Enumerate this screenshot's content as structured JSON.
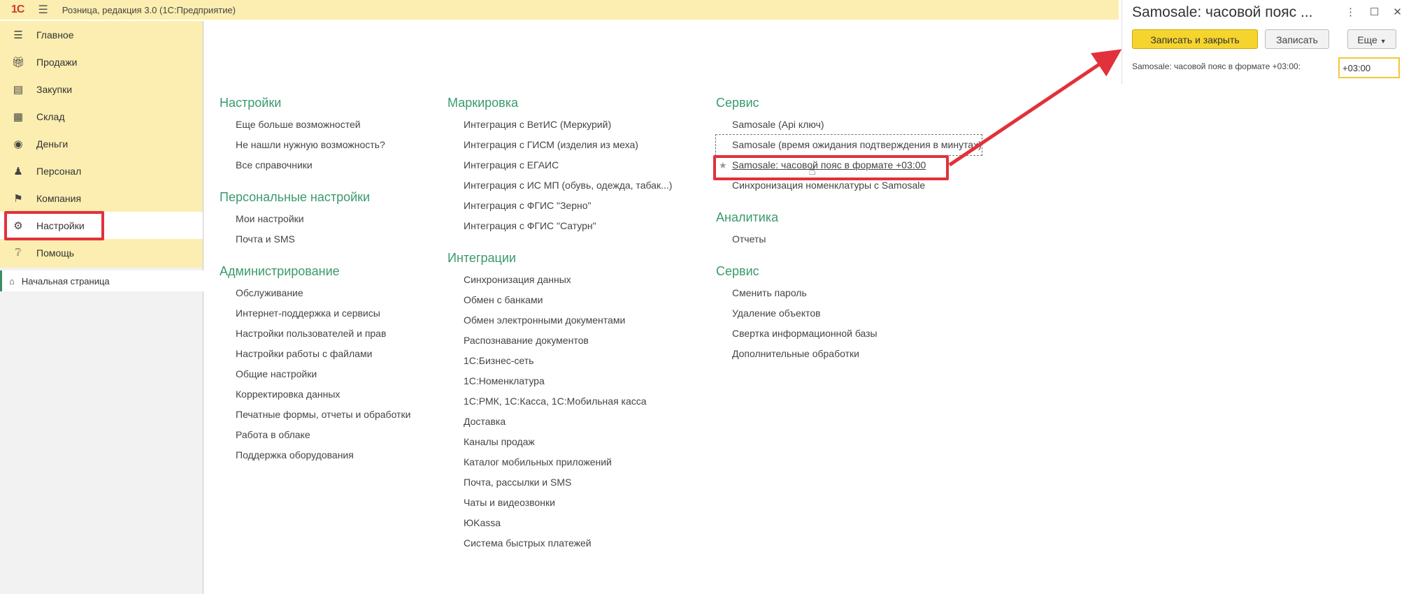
{
  "app": {
    "logo": "1С",
    "title": "Розница, редакция 3.0  (1С:Предприятие)"
  },
  "sidebar": {
    "items": [
      {
        "label": "Главное",
        "icon": "menu-icon"
      },
      {
        "label": "Продажи",
        "icon": "gift-icon"
      },
      {
        "label": "Закупки",
        "icon": "purchases-icon"
      },
      {
        "label": "Склад",
        "icon": "warehouse-icon"
      },
      {
        "label": "Деньги",
        "icon": "money-icon"
      },
      {
        "label": "Персонал",
        "icon": "people-icon"
      },
      {
        "label": "Компания",
        "icon": "flag-icon"
      },
      {
        "label": "Настройки",
        "icon": "gear-icon"
      },
      {
        "label": "Помощь",
        "icon": "help-icon"
      }
    ],
    "home": "Начальная страница"
  },
  "columns": [
    {
      "sections": [
        {
          "title": "Настройки",
          "links": [
            "Еще больше возможностей",
            "Не нашли нужную возможность?",
            "Все справочники"
          ]
        },
        {
          "title": "Персональные настройки",
          "links": [
            "Мои настройки",
            "Почта и SMS"
          ]
        },
        {
          "title": "Администрирование",
          "links": [
            "Обслуживание",
            "Интернет-поддержка и сервисы",
            "Настройки пользователей и прав",
            "Настройки работы с файлами",
            "Общие настройки",
            "Корректировка данных",
            "Печатные формы, отчеты и обработки",
            "Работа в облаке",
            "Поддержка оборудования"
          ]
        }
      ]
    },
    {
      "sections": [
        {
          "title": "Маркировка",
          "links": [
            "Интеграция с ВетИС (Меркурий)",
            "Интеграция с ГИСМ (изделия из меха)",
            "Интеграция с ЕГАИС",
            "Интеграция с ИС МП (обувь, одежда, табак...)",
            "Интеграция с ФГИС \"Зерно\"",
            "Интеграция с ФГИС \"Сатурн\""
          ]
        },
        {
          "title": "Интеграции",
          "links": [
            "Синхронизация данных",
            "Обмен с банками",
            "Обмен электронными документами",
            "Распознавание документов",
            "1С:Бизнес-сеть",
            "1С:Номенклатура",
            "1С:РМК, 1С:Касса, 1С:Мобильная касса",
            "Доставка",
            "Каналы продаж",
            "Каталог мобильных приложений",
            "Почта, рассылки и SMS",
            "Чаты и видеозвонки",
            "ЮKassa",
            "Система быстрых платежей"
          ]
        }
      ]
    },
    {
      "sections": [
        {
          "title": "Сервис",
          "links": [
            "Samosale (Api ключ)",
            "Samosale (время ожидания подтверждения в минутах)",
            "Samosale: часовой пояс в формате +03:00",
            "Синхронизация номенклатуры с Samosale"
          ]
        },
        {
          "title": "Аналитика",
          "links": [
            "Отчеты"
          ]
        },
        {
          "title": "Сервис",
          "links": [
            "Сменить пароль",
            "Удаление объектов",
            "Свертка информационной базы",
            "Дополнительные обработки"
          ]
        }
      ]
    }
  ],
  "popup": {
    "title": "Samosale: часовой пояс ...",
    "save_close": "Записать и закрыть",
    "save": "Записать",
    "more": "Еще",
    "field_label": "Samosale: часовой пояс в формате +03:00:",
    "field_value": "+03:00"
  },
  "colors": {
    "accent_yellow": "#fbeeb0",
    "section_green": "#3a9a6d",
    "highlight_red": "#e2313b",
    "primary_button": "#f6d42e"
  }
}
